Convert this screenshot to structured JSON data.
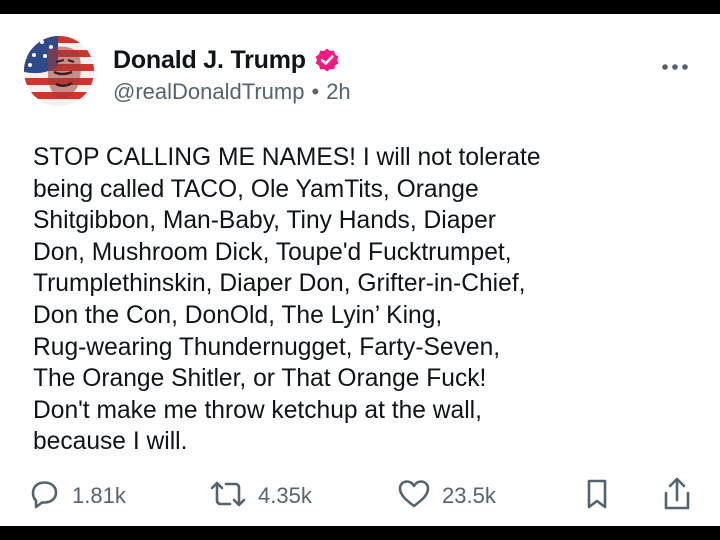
{
  "post": {
    "author_name": "Donald J. Trump",
    "handle": "@realDonaldTrump",
    "separator": "•",
    "time": "2h",
    "verified": true,
    "text": "STOP CALLING ME NAMES! I will not tolerate\nbeing called TACO, Ole YamTits, Orange\nShitgibbon, Man-Baby, Tiny Hands, Diaper\nDon, Mushroom Dick, Toupe'd Fucktrumpet,\nTrumplethinskin, Diaper Don, Grifter-in-Chief,\nDon the Con, DonOld, The Lyin’ King,\nRug-wearing Thundernugget, Farty-Seven,\nThe Orange Shitler, or That Orange Fuck!\nDon't make me throw ketchup at the wall,\nbecause I will."
  },
  "actions": {
    "replies": "1.81k",
    "reposts": "4.35k",
    "likes": "23.5k"
  },
  "icons": {
    "avatar": "flag-face-avatar",
    "verified": "verified-badge-icon",
    "more": "more-dots-icon",
    "reply": "reply-bubble-icon",
    "repost": "repost-arrows-icon",
    "like": "heart-icon",
    "bookmark": "bookmark-icon",
    "share": "share-icon"
  },
  "colors": {
    "text": "#0f1419",
    "secondary": "#536471",
    "verified_badge": "#f91880",
    "frame": "#000000"
  }
}
